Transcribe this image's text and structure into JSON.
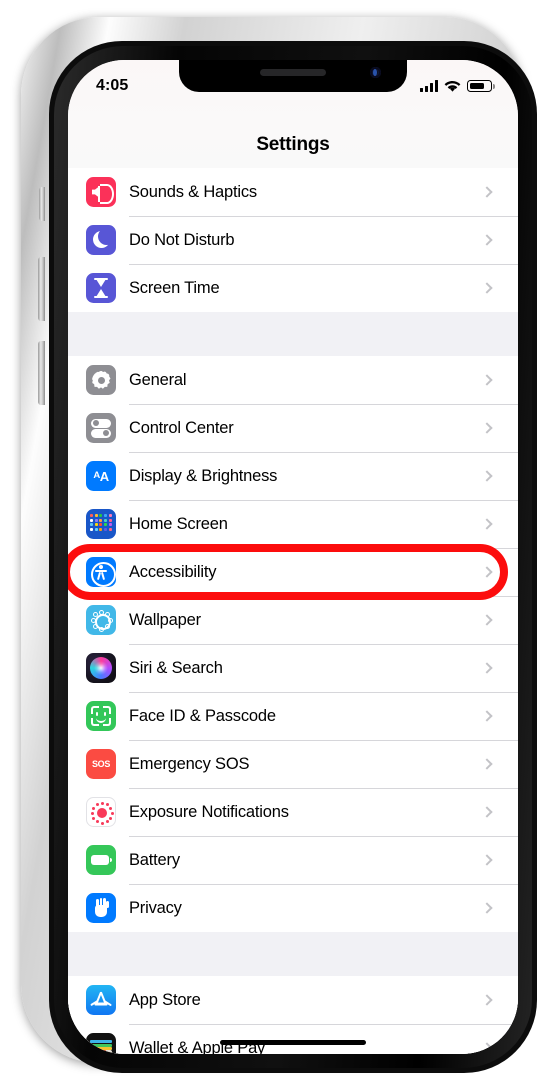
{
  "device": {
    "frame": "iphone",
    "accent_highlight_color": "#fc0d0d"
  },
  "status_bar": {
    "time": "4:05",
    "signal_icon": "cellular-bars-icon",
    "wifi_icon": "wifi-icon",
    "battery_icon": "battery-icon",
    "battery_level_percent": 62
  },
  "nav": {
    "title": "Settings"
  },
  "groups": [
    {
      "id": "group-1",
      "rows": [
        {
          "label": "Sounds & Haptics",
          "icon": "sounds-haptics-icon",
          "icon_color": "#fb3159",
          "chevron": "chevron-right-icon"
        },
        {
          "label": "Do Not Disturb",
          "icon": "do-not-disturb-icon",
          "icon_color": "#5856d6",
          "chevron": "chevron-right-icon"
        },
        {
          "label": "Screen Time",
          "icon": "screen-time-icon",
          "icon_color": "#5856d6",
          "chevron": "chevron-right-icon"
        }
      ]
    },
    {
      "id": "group-2",
      "rows": [
        {
          "label": "General",
          "icon": "gear-icon",
          "icon_color": "#8e8e93",
          "chevron": "chevron-right-icon"
        },
        {
          "label": "Control Center",
          "icon": "control-center-icon",
          "icon_color": "#8e8e93",
          "chevron": "chevron-right-icon"
        },
        {
          "label": "Display & Brightness",
          "icon": "display-brightness-icon",
          "icon_color": "#007aff",
          "chevron": "chevron-right-icon"
        },
        {
          "label": "Home Screen",
          "icon": "home-screen-icon",
          "icon_color": "#1956c8",
          "chevron": "chevron-right-icon"
        },
        {
          "label": "Accessibility",
          "icon": "accessibility-icon",
          "icon_color": "#007aff",
          "chevron": "chevron-right-icon",
          "highlighted": true
        },
        {
          "label": "Wallpaper",
          "icon": "wallpaper-icon",
          "icon_color": "#41b8e8",
          "chevron": "chevron-right-icon"
        },
        {
          "label": "Siri & Search",
          "icon": "siri-search-icon",
          "icon_color": "#1b1726",
          "chevron": "chevron-right-icon"
        },
        {
          "label": "Face ID & Passcode",
          "icon": "face-id-icon",
          "icon_color": "#33c759",
          "chevron": "chevron-right-icon"
        },
        {
          "label": "Emergency SOS",
          "icon": "emergency-sos-icon",
          "icon_color": "#fb4b42",
          "chevron": "chevron-right-icon"
        },
        {
          "label": "Exposure Notifications",
          "icon": "exposure-notifications-icon",
          "icon_color": "#f83a5a",
          "chevron": "chevron-right-icon"
        },
        {
          "label": "Battery",
          "icon": "battery-settings-icon",
          "icon_color": "#35c759",
          "chevron": "chevron-right-icon"
        },
        {
          "label": "Privacy",
          "icon": "privacy-hand-icon",
          "icon_color": "#007aff",
          "chevron": "chevron-right-icon"
        }
      ]
    },
    {
      "id": "group-3",
      "rows": [
        {
          "label": "App Store",
          "icon": "app-store-icon",
          "icon_color": "#1076f2",
          "chevron": "chevron-right-icon"
        },
        {
          "label": "Wallet & Apple Pay",
          "icon": "wallet-icon",
          "icon_color": "#111111",
          "chevron": "chevron-right-icon"
        }
      ]
    }
  ],
  "sos_label": "SOS",
  "display_icon_text": {
    "big": "A",
    "small": "A"
  }
}
